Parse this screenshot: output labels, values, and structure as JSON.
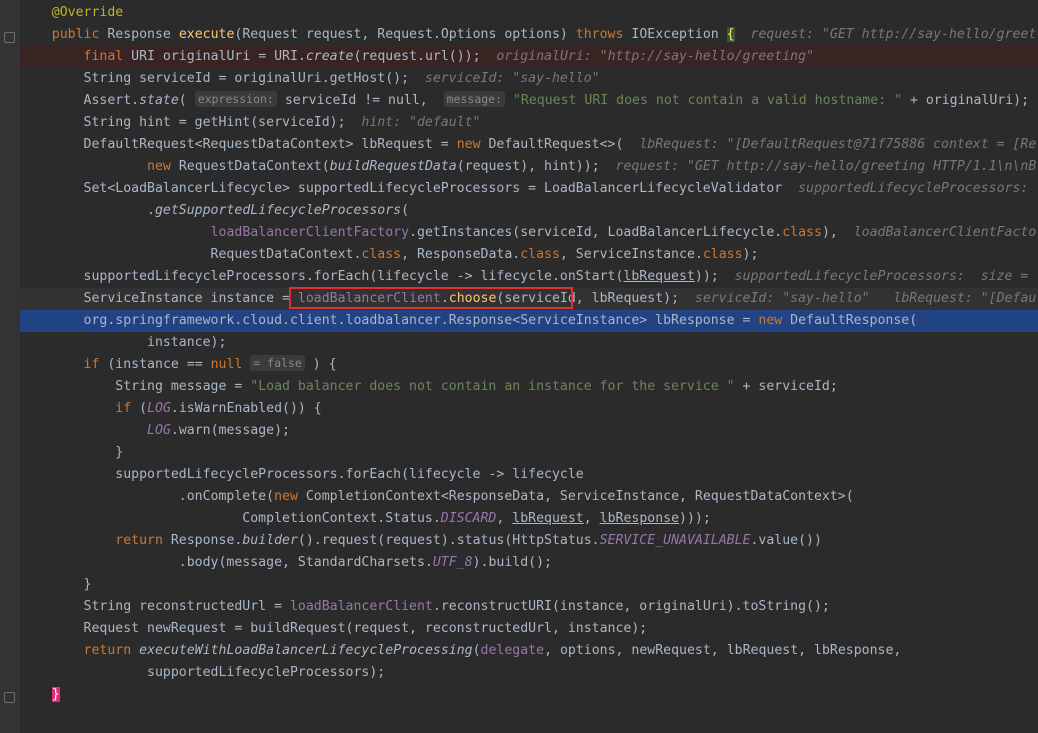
{
  "lines": [
    "@Override",
    "public Response execute(Request request, Request.Options options) throws IOException {",
    "final URI originalUri = URI.create(request.url());",
    "String serviceId = originalUri.getHost();",
    "Assert.state(",
    "String hint = getHint(serviceId);",
    "DefaultRequest<RequestDataContext> lbRequest = new DefaultRequest<>(",
    "new RequestDataContext(buildRequestData(request), hint));",
    "Set<LoadBalancerLifecycle> supportedLifecycleProcessors = LoadBalancerLifecycleValidator",
    ".getSupportedLifecycleProcessors(",
    "loadBalancerClientFactory.getInstances(serviceId, LoadBalancerLifecycle.class),",
    "RequestDataContext.class, ResponseData.class, ServiceInstance.class);",
    "supportedLifecycleProcessors.forEach(lifecycle -> lifecycle.onStart(lbRequest));",
    "ServiceInstance instance = loadBalancerClient.choose(serviceId, lbRequest);",
    "org.springframework.cloud.client.loadbalancer.Response<ServiceInstance> lbResponse = new DefaultResponse(",
    "instance);",
    "if (instance == null",
    "String message = \"Load balancer does not contain an instance for the service \" + serviceId;",
    "if (LOG.isWarnEnabled()) {",
    "LOG.warn(message);",
    "}",
    "supportedLifecycleProcessors.forEach(lifecycle -> lifecycle",
    ".onComplete(new CompletionContext<ResponseData, ServiceInstance, RequestDataContext>(",
    "CompletionContext.Status.DISCARD, lbRequest, lbResponse)));",
    "return Response.builder().request(request).status(HttpStatus.SERVICE_UNAVAILABLE.value())",
    ".body(message, StandardCharsets.UTF_8).build();",
    "}",
    "String reconstructedUrl = loadBalancerClient.reconstructURI(instance, originalUri).toString();",
    "Request newRequest = buildRequest(request, reconstructedUrl, instance);",
    "return executeWithLoadBalancerLifecycleProcessing(delegate, options, newRequest, lbRequest, lbResponse,",
    "supportedLifecycleProcessors);",
    "}"
  ],
  "debug_hints": {
    "execute": "request: \"GET http://say-hello/greet",
    "originalUri": "originalUri: \"http://say-hello/greeting\"",
    "serviceId": "serviceId: \"say-hello\"",
    "assert_tail": "or",
    "hint": "hint: \"default\"",
    "lbRequest": "lbRequest: \"[DefaultRequest@71f75886 context = [Re",
    "request_line": "request: \"GET http://say-hello/greeting HTTP/1.1\\n\\nB",
    "supported": "supportedLifecycleProcessors:",
    "factory": "loadBalancerClientFacto",
    "forEach": "supportedLifecycleProcessors:  size =",
    "choose_serviceId": "serviceId: \"say-hello\"",
    "choose_lbRequest": "lbRequest: \"[Defau"
  },
  "param_hints": {
    "expression": "expression:",
    "message": "message:",
    "false_value": "= false"
  },
  "assert_args": {
    "cond": "serviceId != null,",
    "msg": "\"Request URI does not contain a valid hostname: \"",
    "tail": " + originalUri);"
  },
  "highlight": {
    "selected_line_index": 14,
    "red_box_text": "loadBalancerClient.choose(serviceId"
  }
}
